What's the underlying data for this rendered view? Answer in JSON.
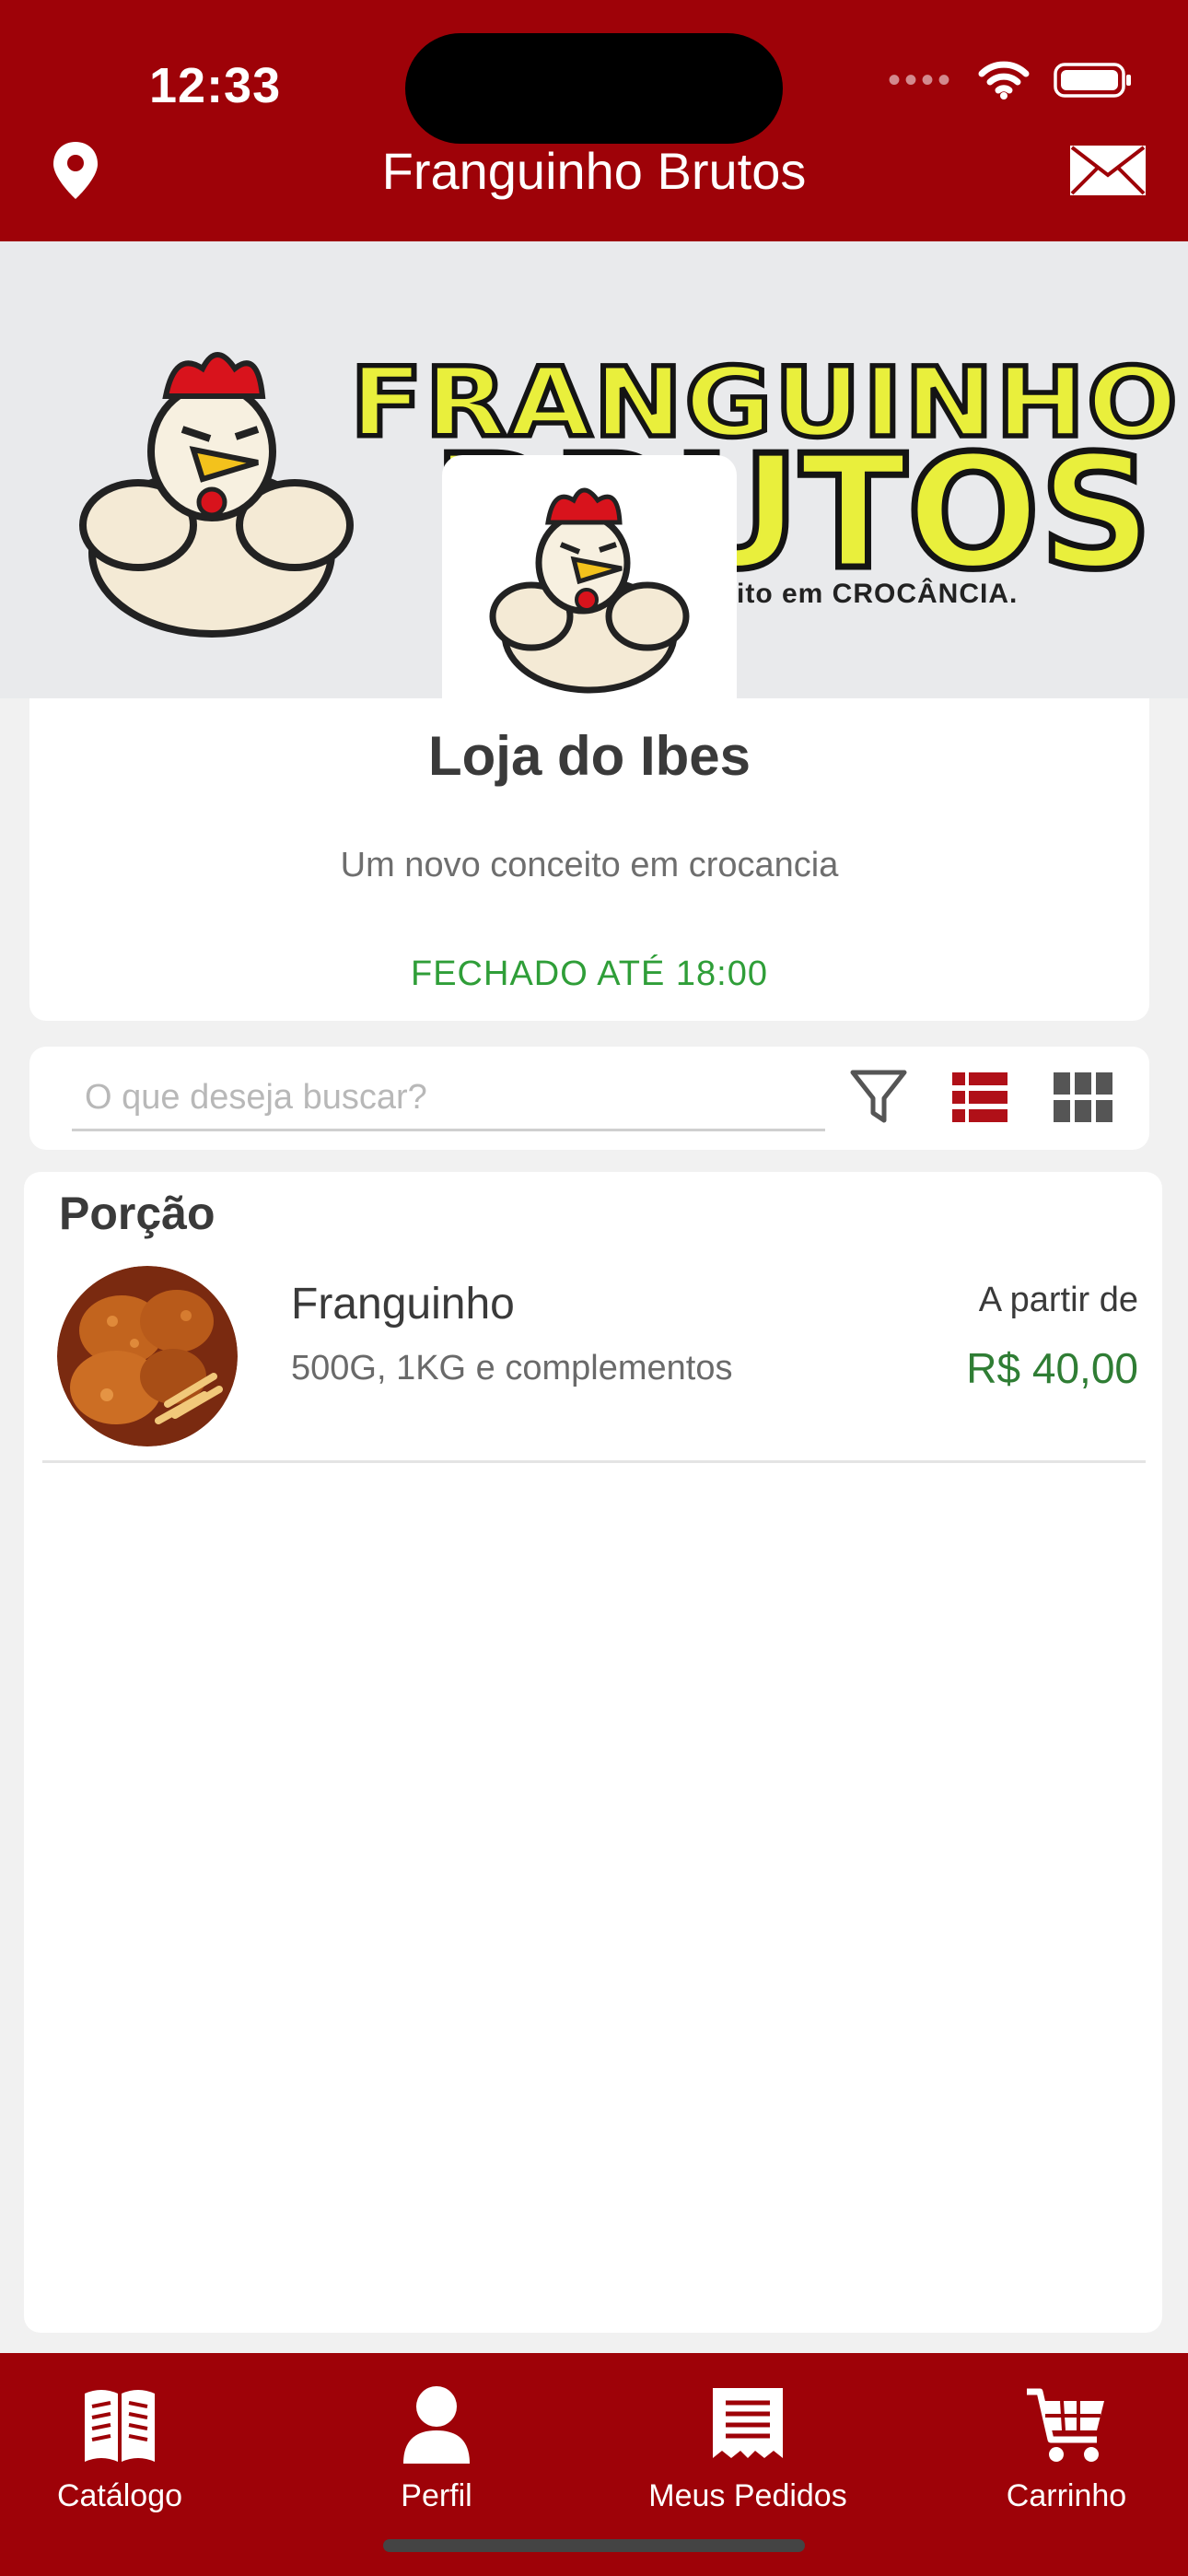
{
  "status_bar": {
    "time": "12:33"
  },
  "header": {
    "title": "Franguinho Brutos"
  },
  "banner": {
    "brand_line_1": "FRANGUINHO",
    "brand_line_2": "BRUTOS",
    "tagline": "ito em CROCÂNCIA."
  },
  "store": {
    "name": "Loja do Ibes",
    "description": "Um novo conceito em crocancia",
    "status": "FECHADO ATÉ 18:00"
  },
  "search": {
    "placeholder": "O que deseja buscar?",
    "value": ""
  },
  "catalog": {
    "category": "Porção",
    "products": [
      {
        "name": "Franguinho",
        "description": "500G, 1KG e complementos",
        "price_prefix": "A partir de",
        "price": "R$ 40,00"
      }
    ]
  },
  "bottom_nav": {
    "items": [
      {
        "label": "Catálogo",
        "icon": "catalog-book-icon"
      },
      {
        "label": "Perfil",
        "icon": "user-icon"
      },
      {
        "label": "Meus Pedidos",
        "icon": "receipt-icon"
      },
      {
        "label": "Carrinho",
        "icon": "cart-icon"
      }
    ]
  },
  "colors": {
    "brand_red": "#9e0208",
    "status_green": "#2f9e38",
    "price_green": "#2f7d34",
    "banner_yellow": "#e9ef3c"
  }
}
